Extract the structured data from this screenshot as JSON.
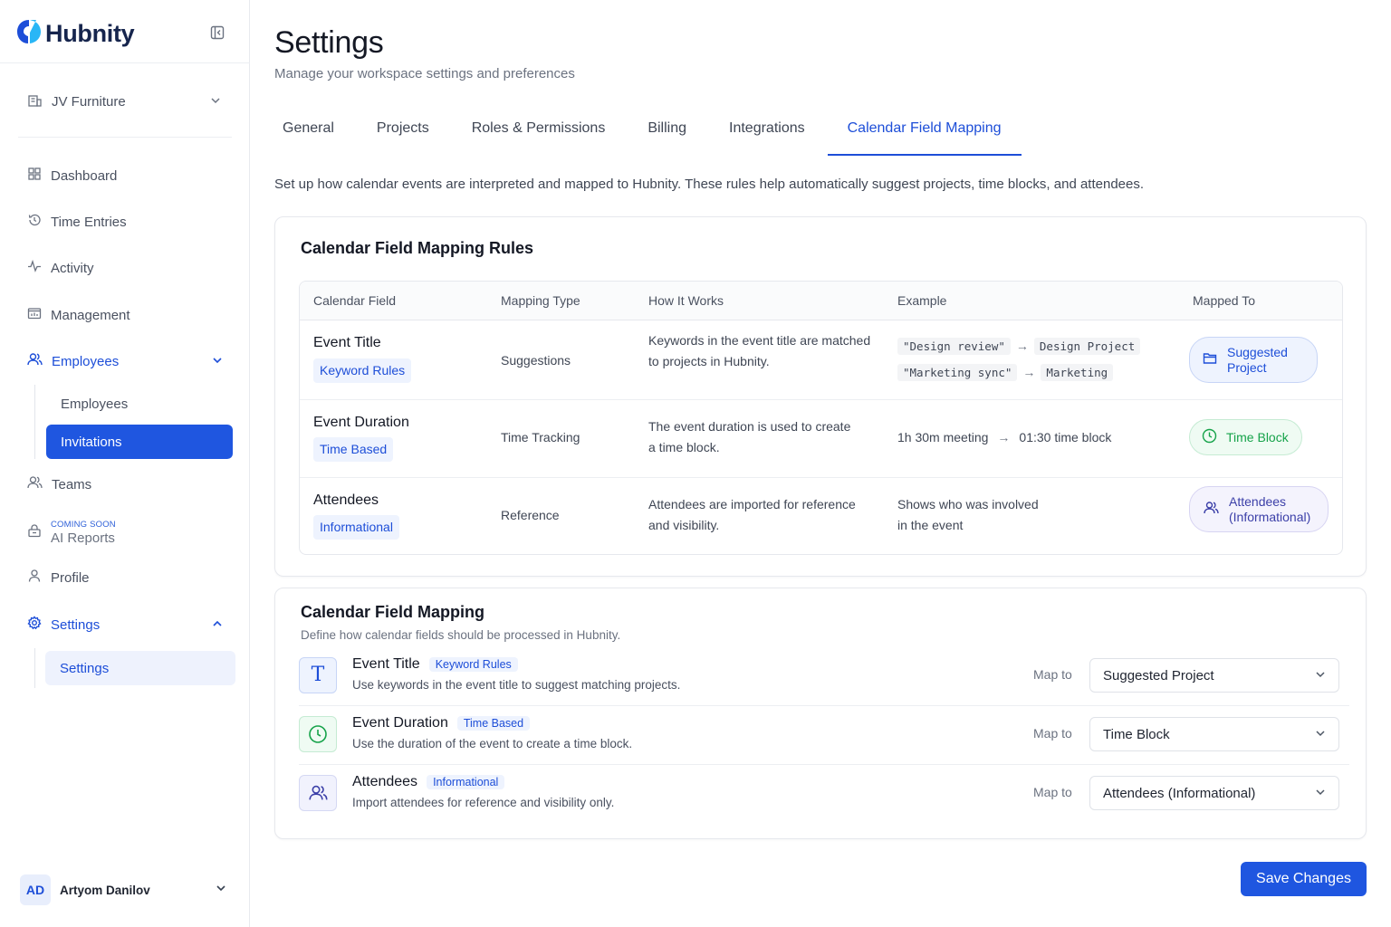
{
  "brand": {
    "name": "Hubnity",
    "color": "#1d4ed8"
  },
  "workspace": {
    "name": "JV Furniture"
  },
  "sidebar": {
    "items": [
      {
        "label": "Dashboard",
        "icon": "grid-icon"
      },
      {
        "label": "Time Entries",
        "icon": "history-icon"
      },
      {
        "label": "Activity",
        "icon": "pulse-icon"
      },
      {
        "label": "Management",
        "icon": "folder-chart-icon"
      },
      {
        "label": "Employees",
        "icon": "users-icon"
      },
      {
        "label": "Teams",
        "icon": "users-icon"
      },
      {
        "label": "AI Reports",
        "badge": "COMING SOON",
        "icon": "lock-icon"
      },
      {
        "label": "Profile",
        "icon": "user-icon"
      },
      {
        "label": "Settings",
        "icon": "gear-icon"
      }
    ],
    "employees_sub": [
      "Employees",
      "Invitations"
    ],
    "settings_sub": [
      "Settings"
    ],
    "active_sub": "Invitations"
  },
  "user": {
    "initials": "AD",
    "name": "Artyom Danilov"
  },
  "page": {
    "title": "Settings",
    "subtitle": "Manage your workspace settings and preferences",
    "intro": "Set up how calendar events are interpreted and mapped to Hubnity. These rules help automatically suggest projects, time blocks, and attendees."
  },
  "tabs": [
    "General",
    "Projects",
    "Roles & Permissions",
    "Billing",
    "Integrations",
    "Calendar Field Mapping"
  ],
  "active_tab": "Calendar Field Mapping",
  "rules": {
    "title": "Calendar Field Mapping Rules",
    "columns": [
      "Calendar Field",
      "Mapping Type",
      "How It Works",
      "Example",
      "Mapped To"
    ],
    "rows": [
      {
        "field": "Event Title",
        "tag": "Keyword Rules",
        "type": "Suggestions",
        "how": [
          "Keywords in the event title are matched",
          "to projects in Hubnity."
        ],
        "examples": [
          {
            "from": "\"Design review\"",
            "to": "Design Project"
          },
          {
            "from": "\"Marketing sync\"",
            "to": "Marketing"
          }
        ],
        "mapped_to": [
          "Suggested",
          "Project"
        ]
      },
      {
        "field": "Event Duration",
        "tag": "Time Based",
        "type": "Time Tracking",
        "how": [
          "The event duration is used to create",
          "a time block."
        ],
        "example_from": "1h 30m meeting",
        "example_to": "01:30 time block",
        "mapped_to": [
          "Time Block"
        ]
      },
      {
        "field": "Attendees",
        "tag": "Informational",
        "type": "Reference",
        "how": [
          "Attendees are imported for reference",
          "and visibility."
        ],
        "example_lines": [
          "Shows who was involved",
          "in the event"
        ],
        "mapped_to": [
          "Attendees",
          "(Informational)"
        ]
      }
    ]
  },
  "mapping": {
    "title": "Calendar Field Mapping",
    "subtitle": "Define how calendar fields should be processed in Hubnity.",
    "map_to_label": "Map to",
    "rows": [
      {
        "title": "Event Title",
        "tag": "Keyword Rules",
        "desc": "Use keywords in the event title to suggest matching projects.",
        "value": "Suggested Project",
        "icon": "text-t-icon"
      },
      {
        "title": "Event Duration",
        "tag": "Time Based",
        "desc": "Use the duration of the event to create a time block.",
        "value": "Time Block",
        "icon": "clock-icon"
      },
      {
        "title": "Attendees",
        "tag": "Informational",
        "desc": "Import attendees for reference and visibility only.",
        "value": "Attendees (Informational)",
        "icon": "users-icon"
      }
    ]
  },
  "save_label": "Save Changes"
}
